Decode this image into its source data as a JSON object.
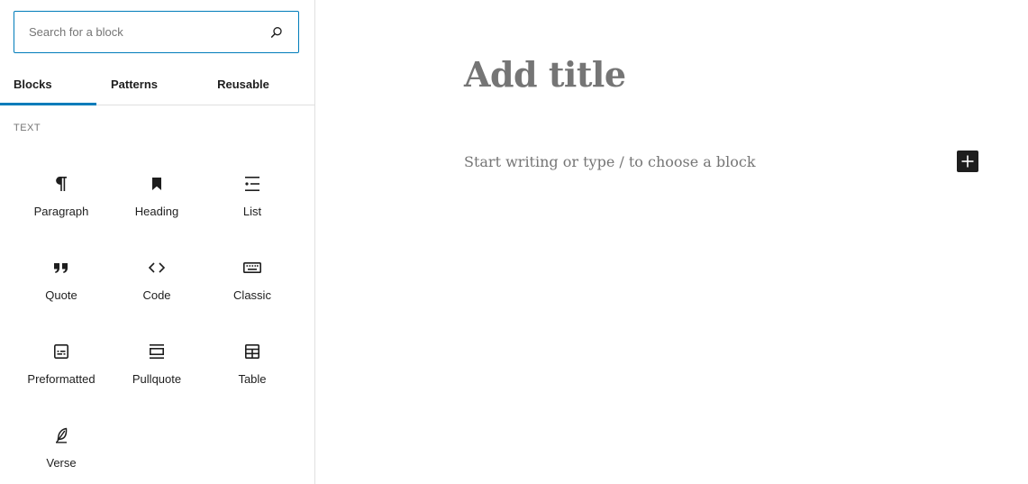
{
  "search": {
    "placeholder": "Search for a block",
    "value": ""
  },
  "tabs": [
    {
      "label": "Blocks",
      "active": true
    },
    {
      "label": "Patterns",
      "active": false
    },
    {
      "label": "Reusable",
      "active": false
    }
  ],
  "category": {
    "title": "TEXT"
  },
  "blocks": [
    {
      "label": "Paragraph",
      "icon": "paragraph-icon"
    },
    {
      "label": "Heading",
      "icon": "heading-icon"
    },
    {
      "label": "List",
      "icon": "list-icon"
    },
    {
      "label": "Quote",
      "icon": "quote-icon"
    },
    {
      "label": "Code",
      "icon": "code-icon"
    },
    {
      "label": "Classic",
      "icon": "classic-icon"
    },
    {
      "label": "Preformatted",
      "icon": "preformatted-icon"
    },
    {
      "label": "Pullquote",
      "icon": "pullquote-icon"
    },
    {
      "label": "Table",
      "icon": "table-icon"
    },
    {
      "label": "Verse",
      "icon": "verse-icon"
    }
  ],
  "editor": {
    "title_placeholder": "Add title",
    "appender_placeholder": "Start writing or type / to choose a block"
  },
  "colors": {
    "accent": "#007cba",
    "text": "#1e1e1e",
    "muted": "#757575",
    "border": "#e0e0e0"
  }
}
